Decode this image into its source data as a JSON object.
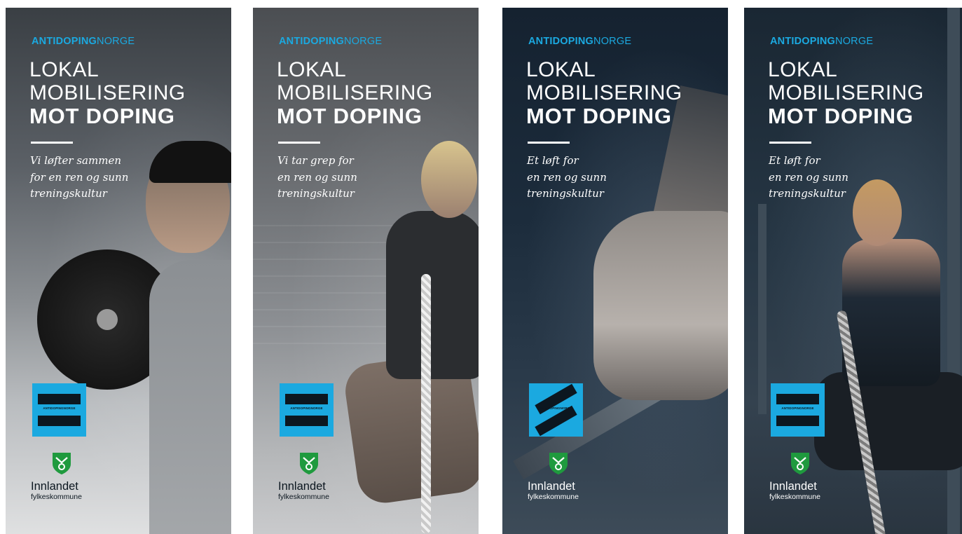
{
  "brand": {
    "bold": "ANTIDOPING",
    "light": "NORGE"
  },
  "title": {
    "line1": "LOKAL",
    "line2": "MOBILISERING",
    "line3": "MOT DOPING"
  },
  "badge_text": "ANTIDOPINGNORGE",
  "county": {
    "name": "Innlandet",
    "sub": "fylkeskommune"
  },
  "colors": {
    "accent": "#1ba9e0",
    "dark": "#0c1720",
    "shield_green": "#1f9a3e"
  },
  "panels": [
    {
      "tagline": [
        "Vi løfter sammen",
        "for en ren og sunn",
        "treningskultur"
      ]
    },
    {
      "tagline": [
        "Vi tar grep for",
        "en ren og sunn",
        "treningskultur"
      ]
    },
    {
      "tagline": [
        "Et løft for",
        "en ren og sunn",
        "treningskultur"
      ]
    },
    {
      "tagline": [
        "Et løft for",
        "en ren og sunn",
        "treningskultur"
      ]
    }
  ]
}
